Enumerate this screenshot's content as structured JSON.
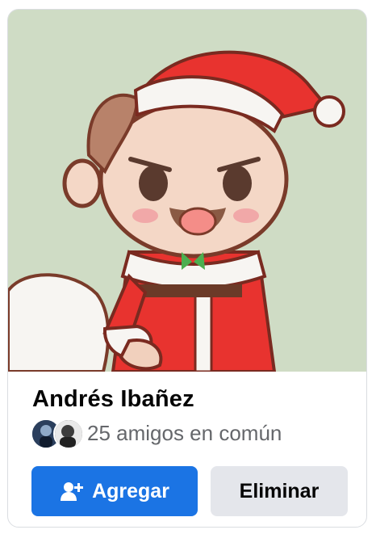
{
  "card": {
    "name": "Andrés Ibañez",
    "mutual_friends_text": "25 amigos en común",
    "photo_icon": "cartoon-santa-avatar"
  },
  "actions": {
    "add_label": "Agregar",
    "add_icon": "add-friend-icon",
    "remove_label": "Eliminar"
  },
  "colors": {
    "primary": "#1b74e4",
    "secondary_button": "#e4e6eb",
    "text_primary": "#050505",
    "text_secondary": "#65676b",
    "photo_background": "#cfdcc5"
  }
}
